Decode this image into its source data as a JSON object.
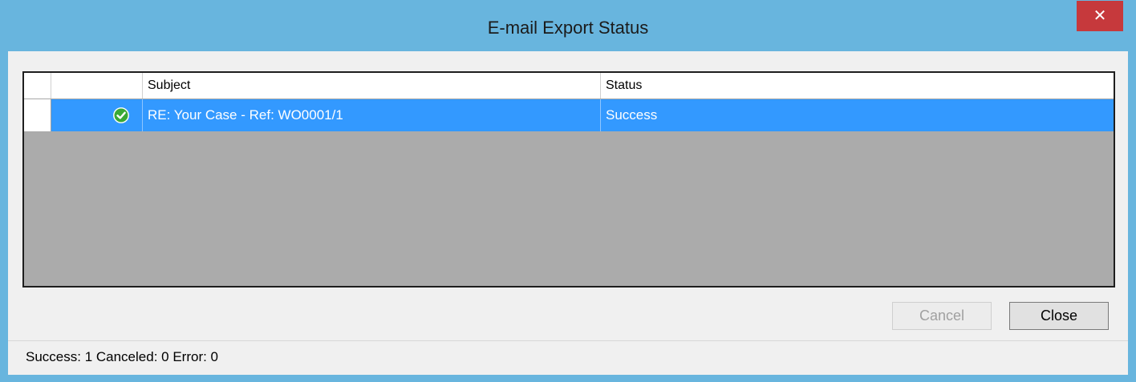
{
  "window": {
    "title": "E-mail Export Status",
    "close_glyph": "✕",
    "title_bar_color": "#68b5de",
    "close_button_color": "#c6393c"
  },
  "grid": {
    "columns": [
      {
        "key": "row_header",
        "label": ""
      },
      {
        "key": "icon",
        "label": ""
      },
      {
        "key": "subject",
        "label": "Subject"
      },
      {
        "key": "status",
        "label": "Status"
      }
    ],
    "rows": [
      {
        "icon": "check-circle-icon",
        "subject": "RE: Your Case - Ref: WO0001/1",
        "status": "Success",
        "selected": true
      }
    ],
    "selection_color": "#3399ff",
    "empty_area_color": "#ababab"
  },
  "buttons": {
    "cancel_label": "Cancel",
    "cancel_enabled": false,
    "close_label": "Close"
  },
  "status_bar": {
    "text": "Success: 1 Canceled: 0 Error: 0"
  }
}
